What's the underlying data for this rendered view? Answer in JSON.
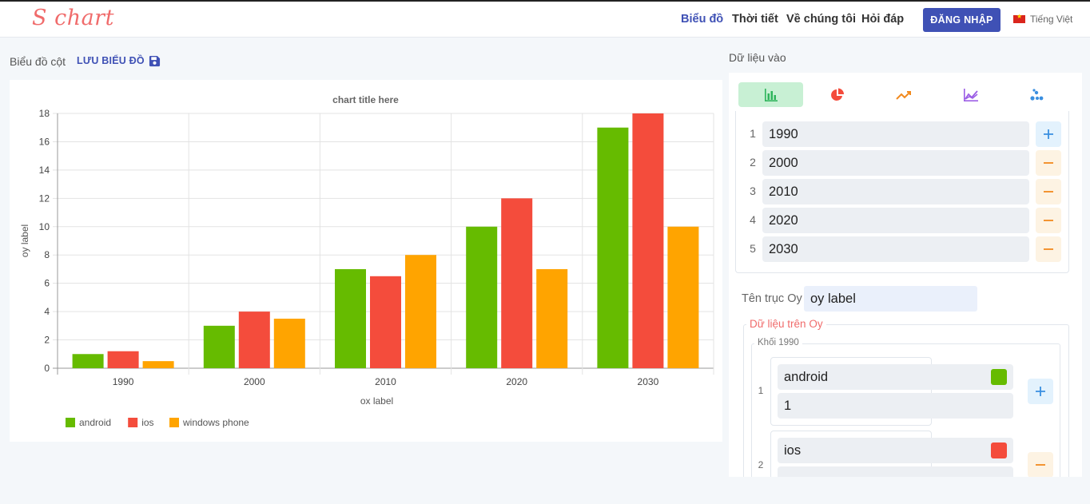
{
  "header": {
    "logo": "S chart",
    "nav": [
      "Biểu đồ",
      "Thời tiết",
      "Về chúng tôi",
      "Hỏi đáp"
    ],
    "login_label": "ĐĂNG NHẬP",
    "language": "Tiếng Việt"
  },
  "chart_panel": {
    "chart_type_label": "Biểu đồ cột",
    "save_label": "LƯU BIỂU ĐỒ"
  },
  "chart_data": {
    "type": "bar",
    "title": "chart title here",
    "xlabel": "ox label",
    "ylabel": "oy label",
    "categories": [
      "1990",
      "2000",
      "2010",
      "2020",
      "2030"
    ],
    "ylim": [
      0,
      18
    ],
    "yticks": [
      0,
      2,
      4,
      6,
      8,
      10,
      12,
      14,
      16,
      18
    ],
    "grid": true,
    "legend_position": "bottom-left",
    "series": [
      {
        "name": "android",
        "color": "#66bb00",
        "values": [
          1,
          3,
          7,
          10,
          17
        ]
      },
      {
        "name": "ios",
        "color": "#f44c3c",
        "values": [
          1.2,
          4,
          6.5,
          12,
          18
        ]
      },
      {
        "name": "windows phone",
        "color": "#ffa400",
        "values": [
          0.5,
          3.5,
          8,
          7,
          10
        ]
      }
    ]
  },
  "input_panel": {
    "title": "Dữ liệu vào",
    "tabs": [
      "bar-chart-icon",
      "pie-chart-icon",
      "line-chart-icon",
      "area-chart-icon",
      "scatter-chart-icon"
    ],
    "active_tab": 0,
    "x_rows": [
      {
        "num": "1",
        "value": "1990"
      },
      {
        "num": "2",
        "value": "2000"
      },
      {
        "num": "3",
        "value": "2010"
      },
      {
        "num": "4",
        "value": "2020"
      },
      {
        "num": "5",
        "value": "2030"
      }
    ],
    "oy_name_label": "Tên trục Oy",
    "oy_name_value": "oy label",
    "oy_data_legend": "Dữ liệu trên Oy",
    "block_legend": "Khối 1990",
    "series_rows": [
      {
        "num": "1",
        "name": "android",
        "value": "1",
        "color": "#66bb00"
      },
      {
        "num": "2",
        "name": "ios",
        "value": "",
        "color": "#f44c3c"
      }
    ]
  }
}
